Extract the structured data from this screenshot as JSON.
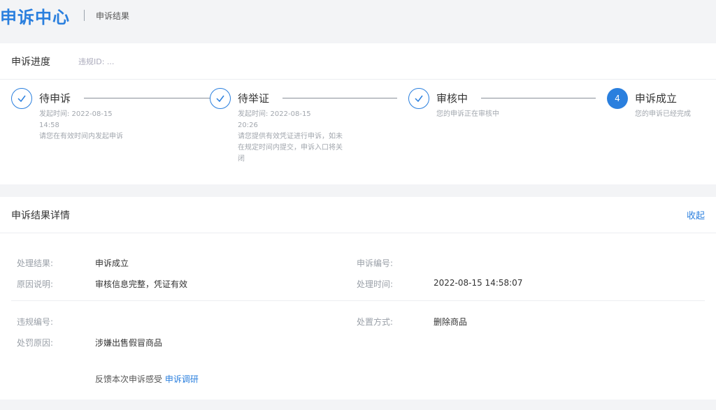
{
  "header": {
    "title": "申诉中心",
    "subtitle": "申诉结果"
  },
  "progress": {
    "title": "申诉进度",
    "id_label": "违规ID: ...",
    "steps": [
      {
        "title": "待申诉",
        "time": "发起时间: 2022-08-15",
        "time2": "14:58",
        "desc": "请您在有效时间内发起申诉",
        "status": "done"
      },
      {
        "title": "待举证",
        "time": "发起时间: 2022-08-15",
        "time2": "20:26",
        "desc": "请您提供有效凭证进行申诉，如未在规定时间内提交，申诉入口将关闭",
        "status": "done"
      },
      {
        "title": "审核中",
        "time": "",
        "time2": "",
        "desc": "您的申诉正在审核中",
        "status": "done"
      },
      {
        "title": "申诉成立",
        "time": "",
        "time2": "",
        "desc": "您的申诉已经完成",
        "status": "active",
        "number": "4"
      }
    ]
  },
  "detail": {
    "title": "申诉结果详情",
    "collapse_label": "收起",
    "fields": {
      "result_label": "处理结果:",
      "result_value": "申诉成立",
      "reason_label": "原因说明:",
      "reason_value": "审核信息完整，凭证有效",
      "appeal_no_label": "申诉编号:",
      "appeal_no_value": "",
      "time_label": "处理时间:",
      "time_value": "2022-08-15 14:58:07",
      "violation_no_label": "违规编号:",
      "violation_no_value": "",
      "method_label": "处置方式:",
      "method_value": "删除商品",
      "penalty_label": "处罚原因:",
      "penalty_value": "涉嫌出售假冒商品"
    },
    "feedback_text": "反馈本次申诉感受",
    "feedback_link": "申诉调研"
  },
  "colors": {
    "accent": "#2a7fde",
    "background": "#f3f4f6"
  }
}
